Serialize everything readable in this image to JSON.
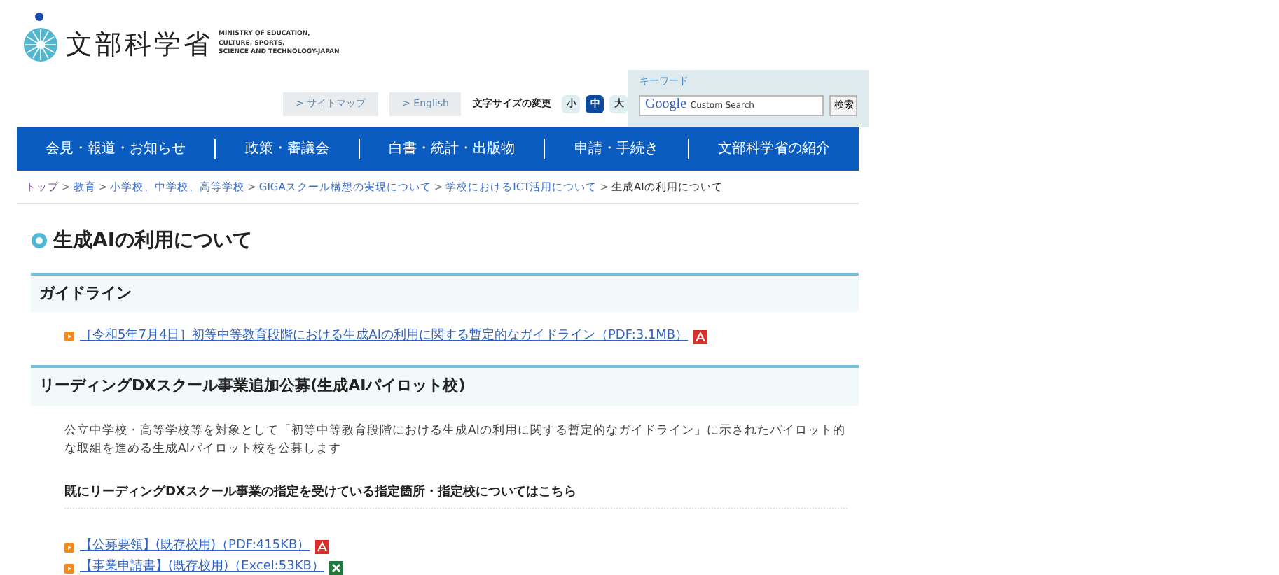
{
  "logo": {
    "name": "文部科学省",
    "english": [
      "MINISTRY OF EDUCATION,",
      "CULTURE, SPORTS,",
      "SCIENCE AND TECHNOLOGY-JAPAN"
    ]
  },
  "utility_links": [
    "> サイトマップ",
    "> English"
  ],
  "font_size": {
    "label": "文字サイズの変更",
    "options": [
      {
        "label": "小",
        "selected": false
      },
      {
        "label": "中",
        "selected": true
      },
      {
        "label": "大",
        "selected": false
      }
    ]
  },
  "search": {
    "label": "キーワード",
    "brand": "Google",
    "placeholder": "Custom Search",
    "button": "検索"
  },
  "nav": [
    "会見・報道・お知らせ",
    "政策・審議会",
    "白書・統計・出版物",
    "申請・手続き",
    "文部科学省の紹介"
  ],
  "breadcrumb_separator": ">",
  "breadcrumb": [
    {
      "label": "トップ",
      "visited": true
    },
    {
      "label": "教育",
      "visited": false
    },
    {
      "label": "小学校、中学校、高等学校",
      "visited": false
    },
    {
      "label": "GIGAスクール構想の実現について",
      "visited": false
    },
    {
      "label": "学校におけるICT活用について",
      "visited": false
    },
    {
      "label": "生成AIの利用について",
      "current": true
    }
  ],
  "title": "生成AIの利用について",
  "sections": [
    {
      "heading": "ガイドライン",
      "links": [
        {
          "text": "［令和5年7月4日］初等中等教育段階における生成AIの利用に関する暫定的なガイドライン（PDF:3.1MB）",
          "kind": "pdf"
        }
      ]
    },
    {
      "heading": "リーディングDXスクール事業追加公募(生成AIパイロット校)",
      "paragraph": "公立中学校・高等学校等を対象として「初等中等教育段階における生成AIの利用に関する暫定的なガイドライン」に示されたパイロット的な取組を進める生成AIパイロット校を公募します",
      "subheading": "既にリーディングDXスクール事業の指定を受けている指定箇所・指定校についてはこちら",
      "links": [
        {
          "text": "【公募要領】(既存校用)（PDF:415KB）",
          "kind": "pdf"
        },
        {
          "text": "【事業申請書】(既存校用)（Excel:53KB）",
          "kind": "excel"
        }
      ]
    }
  ]
}
